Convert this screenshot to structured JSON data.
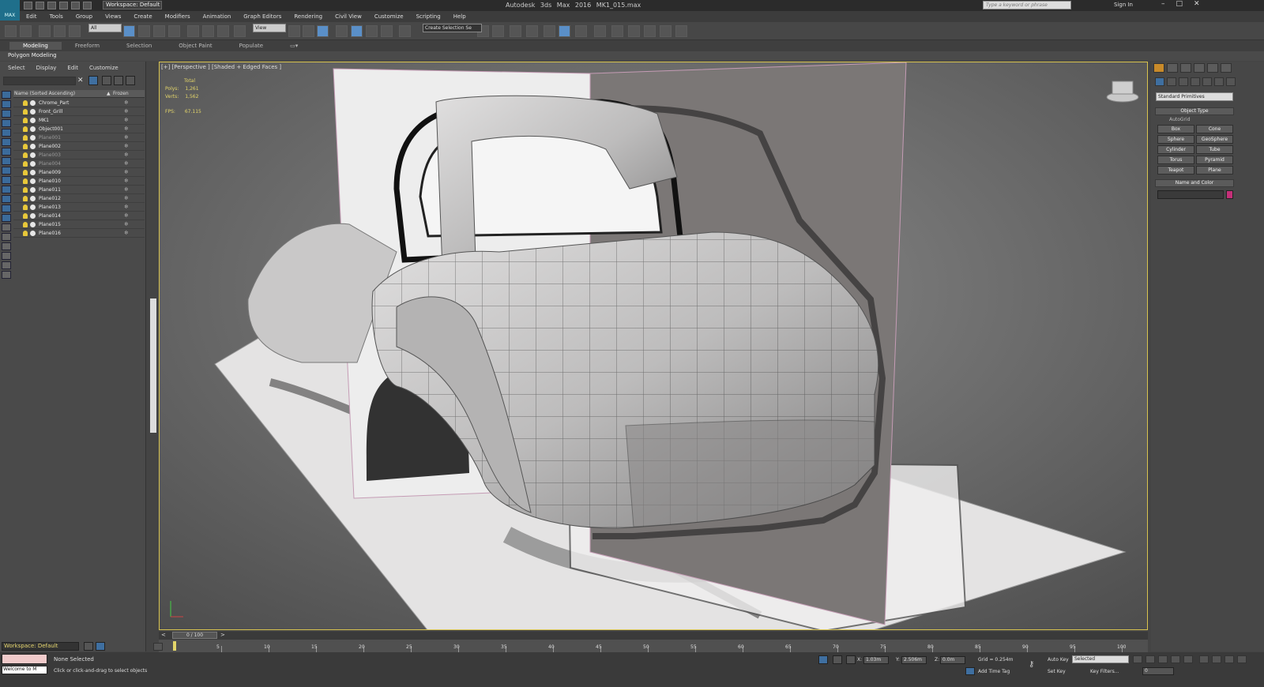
{
  "titlebar": {
    "workspace": "Workspace: Default",
    "app_title": "Autodesk 3ds Max 2016",
    "file_name": "MK1_015.max",
    "search_placeholder": "Type a keyword or phrase",
    "sign_in": "Sign In"
  },
  "menu": [
    "Edit",
    "Tools",
    "Group",
    "Views",
    "Create",
    "Modifiers",
    "Animation",
    "Graph Editors",
    "Rendering",
    "Civil View",
    "Customize",
    "Scripting",
    "Help"
  ],
  "toolbar": {
    "selection_filter": "All",
    "reference_coord": "View",
    "named_selection": "Create Selection Se"
  },
  "ribbon": {
    "tabs": [
      "Modeling",
      "Freeform",
      "Selection",
      "Object Paint",
      "Populate"
    ],
    "active_tab": "Modeling",
    "panel_label": "Polygon Modeling"
  },
  "scene_explorer": {
    "menu": [
      "Select",
      "Display",
      "Edit",
      "Customize"
    ],
    "col_name": "Name (Sorted Ascending)",
    "col_frozen": "Frozen",
    "items": [
      {
        "name": "Chrome_Part",
        "dim": false
      },
      {
        "name": "Front_Grill",
        "dim": false
      },
      {
        "name": "MK1",
        "dim": false
      },
      {
        "name": "Object001",
        "dim": false
      },
      {
        "name": "Plane001",
        "dim": true
      },
      {
        "name": "Plane002",
        "dim": false
      },
      {
        "name": "Plane003",
        "dim": true
      },
      {
        "name": "Plane004",
        "dim": true
      },
      {
        "name": "Plane009",
        "dim": false
      },
      {
        "name": "Plane010",
        "dim": false
      },
      {
        "name": "Plane011",
        "dim": false
      },
      {
        "name": "Plane012",
        "dim": false
      },
      {
        "name": "Plane013",
        "dim": false
      },
      {
        "name": "Plane014",
        "dim": false
      },
      {
        "name": "Plane015",
        "dim": false
      },
      {
        "name": "Plane016",
        "dim": false
      }
    ],
    "workspace": "Workspace: Default"
  },
  "viewport": {
    "label": "[+] [Perspective ] [Shaded + Edged Faces ]",
    "stats": {
      "total": "Total",
      "polys_label": "Polys:",
      "polys": "1,261",
      "verts_label": "Verts:",
      "verts": "1,562",
      "fps_label": "FPS:",
      "fps": "67.115"
    }
  },
  "command_panel": {
    "category": "Standard Primitives",
    "object_type": "Object Type",
    "autogrid": "AutoGrid",
    "primitives": [
      "Box",
      "Cone",
      "Sphere",
      "GeoSphere",
      "Cylinder",
      "Tube",
      "Torus",
      "Pyramid",
      "Teapot",
      "Plane"
    ],
    "name_and_color": "Name and Color",
    "object_color": "#c42f78"
  },
  "timeline": {
    "frame_label": "0 / 100",
    "ticks": [
      "5",
      "10",
      "15",
      "20",
      "25",
      "30",
      "35",
      "40",
      "45",
      "50",
      "55",
      "60",
      "65",
      "70",
      "75",
      "80",
      "85",
      "90",
      "95",
      "100"
    ]
  },
  "status": {
    "maxscript": "Welcome to M",
    "selection": "None Selected",
    "prompt": "Click or click-and-drag to select objects",
    "x_label": "X:",
    "x": "1.03m",
    "y_label": "Y:",
    "y": "2.506m",
    "z_label": "Z:",
    "z": "0.0m",
    "grid": "Grid = 0.254m",
    "add_time_tag": "Add Time Tag",
    "auto_key": "Auto Key",
    "set_key": "Set Key",
    "key_mode": "Selected",
    "key_filters": "Key Filters...",
    "current_frame": "0"
  },
  "colors": {
    "viewport_border": "#d8c34f",
    "stats_text": "#e3d56a",
    "background": "#444444"
  }
}
